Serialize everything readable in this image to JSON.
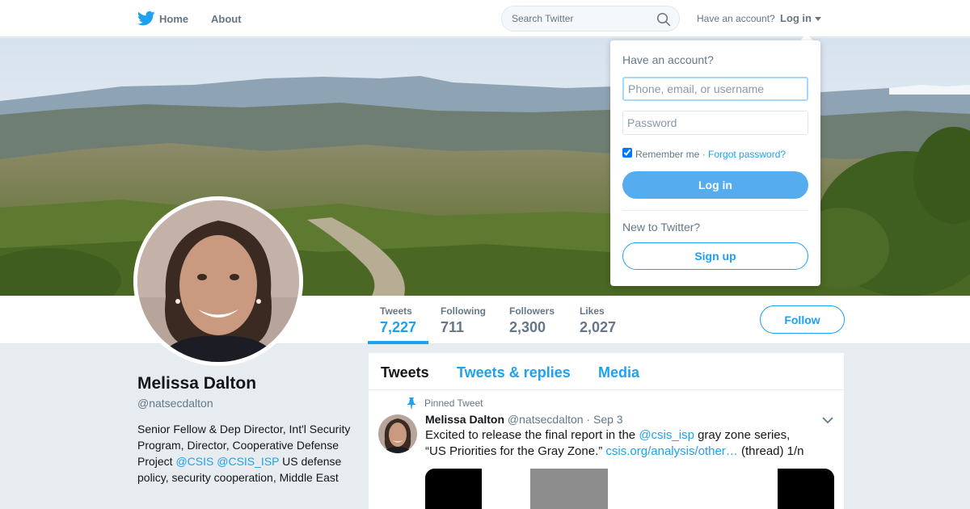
{
  "nav": {
    "home": "Home",
    "about": "About",
    "search_placeholder": "Search Twitter",
    "have_account": "Have an account?",
    "login": "Log in"
  },
  "profile": {
    "name": "Melissa Dalton",
    "handle": "@natsecdalton",
    "bio_prefix": "Senior Fellow & Dep Director, Int'l Security Program, Director, Cooperative Defense Project ",
    "bio_link1": "@CSIS",
    "bio_link2": "@CSIS_ISP",
    "bio_suffix": " US defense policy, security cooperation, Middle East",
    "stats": [
      {
        "label": "Tweets",
        "value": "7,227"
      },
      {
        "label": "Following",
        "value": "711"
      },
      {
        "label": "Followers",
        "value": "2,300"
      },
      {
        "label": "Likes",
        "value": "2,027"
      }
    ],
    "follow": "Follow"
  },
  "timeline": {
    "tabs": [
      "Tweets",
      "Tweets & replies",
      "Media"
    ],
    "pinned_label": "Pinned Tweet",
    "tweet": {
      "name": "Melissa Dalton",
      "handle": "@natsecdalton",
      "dot": "·",
      "date": "Sep 3",
      "text_a": "Excited to release the final report in the ",
      "mention": "@csis_isp",
      "text_b": " gray zone series, “US Priorities for the Gray Zone.” ",
      "link": "csis.org/analysis/other…",
      "text_c": " (thread) 1/n"
    }
  },
  "login_dropdown": {
    "title": "Have an account?",
    "username_placeholder": "Phone, email, or username",
    "password_placeholder": "Password",
    "remember": "Remember me",
    "separator": " · ",
    "forgot": "Forgot password?",
    "login_button": "Log in",
    "new_to": "New to Twitter?",
    "signup_button": "Sign up"
  },
  "colors": {
    "brand": "#1da1f2",
    "login_button": "#55acee",
    "background": "#e6ecf0"
  },
  "icons": [
    "twitter-bird-icon",
    "search-icon",
    "caret-down-icon",
    "pin-icon",
    "chevron-down-icon"
  ]
}
